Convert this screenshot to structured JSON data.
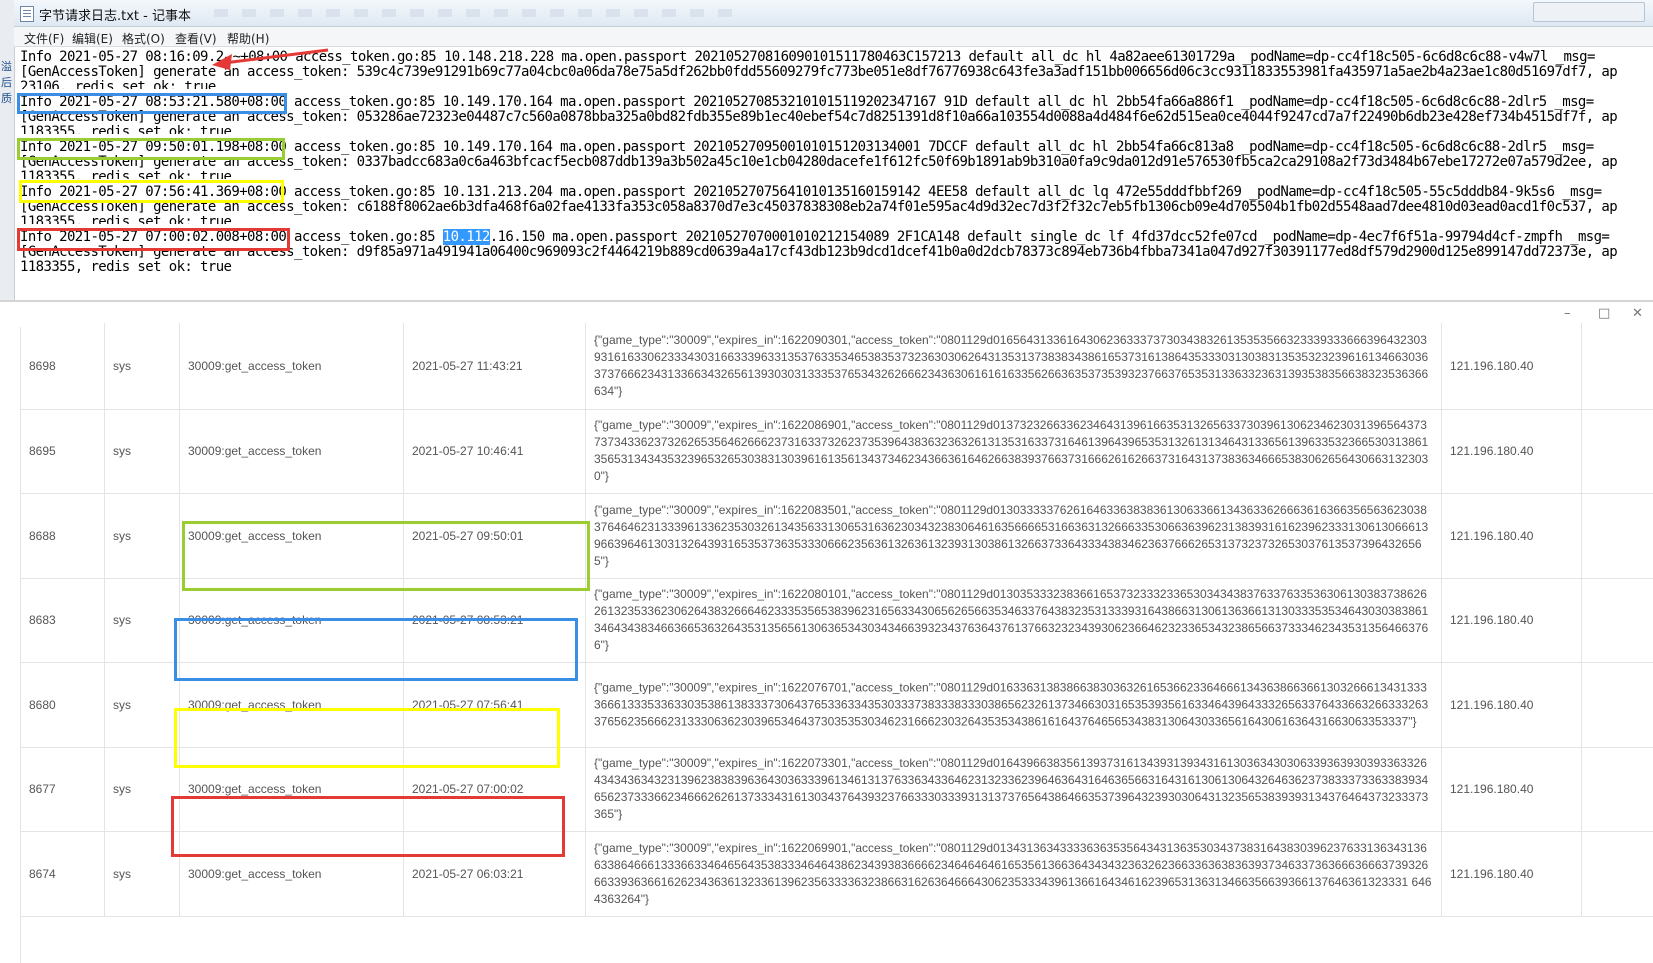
{
  "notepad": {
    "title": "字节请求日志.txt - 记事本",
    "side_chars": [
      "溢",
      "后",
      "质"
    ],
    "menu": [
      "文件(F)",
      "编辑(E)",
      "格式(O)",
      "查看(V)",
      "帮助(H)"
    ],
    "lines": [
      {
        "pre": "Info 2021-05-27 08:16:09.",
        "sel": "",
        "post": "2̵̴+08:00 access_token.go:85 10.148.218.228 ma.open.passport 202105270816090101511780463C157213 default all_dc hl 4a82aee61301729a _podName=dp-cc4f18c505-6c6d8c6c88-v4w7l _msg="
      },
      {
        "pre": "[GenAccessToken] generate an access_token: 539c4c739e91291b69c77a04cbc0a06da78e75a5df262bb0fdd55609279fc773be051e8df76776938c643fe3a3adf151bb006656d06c3cc9311833553981fa435971a5ae2b4a23ae1c80d51697df7, ap",
        "sel": "",
        "post": ""
      },
      {
        "pre": "23106, redis set ok: true",
        "sel": "",
        "post": "",
        "cut": true
      },
      {
        "pre": "Info 2021-05-27 08:53:21.580+08:00 access_token.go:85 10.149.170.164 ma.open.passport 2021052708532101015119202347167 91D default all_dc hl 2bb54fa66a886f1 _podName=dp-cc4f18c505-6c6d8c6c88-2dlr5 _msg=",
        "sel": "",
        "post": ""
      },
      {
        "pre": "[GenAccessToken] generate an access_token: 053286ae72323e04487c7c560a0878bba325a0bd82fdb355e89b1ec40ebef54c7d8251391d8f10a66a103554d0088a4d484f6e62d515ea0ce4044f9247cd7a7f22490b6db23e428ef734b4515df7f, ap",
        "sel": "",
        "post": ""
      },
      {
        "pre": "1183355, redis set ok: true",
        "sel": "",
        "post": "",
        "cut": true
      },
      {
        "pre": "Info 2021-05-27 09:50:01.198+08:00 access_token.go:85 10.149.170.164 ma.open.passport 20210527095001010151203134001 7DCCF default all_dc hl 2bb54fa66c813a8 _podName=dp-cc4f18c505-6c6d8c6c88-2dlr5 _msg=",
        "sel": "",
        "post": ""
      },
      {
        "pre": "[GenAccessToken] generate an access_token: 0337badcc683a0c6a463bfcacf5ecb087ddb139a3b502a45c10e1cb04280dacefe1f612fc50f69b1891ab9b310a0fa9c9da012d91e576530fb5ca2ca29108a2f73d3484b67ebe17272e07a579d2ee, ap",
        "sel": "",
        "post": ""
      },
      {
        "pre": "1183355, redis set ok: true",
        "sel": "",
        "post": "",
        "cut": true
      },
      {
        "pre": "Info 2021-05-27 07:56:41.369+08:00 access_token.go:85 10.131.213.204 ma.open.passport 20210527075641010135160159142 4EE58 default all_dc lq 472e55dddfbbf269 _podName=dp-cc4f18c505-55c5dddb84-9k5s6 _msg=",
        "sel": "",
        "post": ""
      },
      {
        "pre": "[GenAccessToken] generate an access_token: c6188f8062ae6b3dfa468f6a02fae4133fa353c058a8370d7e3c45037838308eb2a74f01e595ac4d9d32ec7d3f2f32c7eb5fb1306cb09e4d705504b1fb02d5548aad7dee4810d03ead0acd1f0c537, ap",
        "sel": "",
        "post": ""
      },
      {
        "pre": "1183355, redis set ok: true",
        "sel": "",
        "post": "",
        "cut": true
      },
      {
        "pre": "Info 2021-05-27 07:00:02.008+08:00 access_token.go:85 ",
        "sel": "10.112",
        "post": ".16.150 ma.open.passport 20210527070001010212154089 2F1CA148 default single_dc lf 4fd37dcc52fe07cd _podName=dp-4ec7f6f51a-99794d4cf-zmpfh _msg="
      },
      {
        "pre": "[GenAccessToken] generate an access_token: d9f85a971a491941a06400c969093c2f4464219b889cd0639a4a17cf43db123b9dcd1dcef41b0a0d2dcb78373c894eb736b4fbba7341a047d927f30391177ed8df579d2900d125e899147dd72373e, ap",
        "sel": "",
        "post": ""
      },
      {
        "pre": "1183355, redis set ok: true",
        "sel": "",
        "post": ""
      }
    ]
  },
  "table_window": {
    "controls": [
      "–",
      "□",
      "✕"
    ]
  },
  "table": {
    "rows": [
      {
        "id": "8698",
        "user": "sys",
        "action": "30009:get_access_token",
        "time": "2021-05-27 11:43:21",
        "response": "{\"game_type\":\"30009\",\"expires_in\":1622090301,\"access_token\":\"0801129d016564313361643062363337373034383261353535663233393336663964323039316163306233343031663339633135376335346538353732363030626431353137383834386165373161386435333031303831353532323961613466303637376662343133663432656139303031333537653432626662343630616161633562663635373539323766376535313363323631393538356638323536366634\"}",
        "ip": "121.196.180.40"
      },
      {
        "id": "8695",
        "user": "sys",
        "action": "30009:get_access_token",
        "time": "2021-05-27 10:46:41",
        "response": "{\"game_type\":\"30009\",\"expires_in\":1622086901,\"access_token\":\"0801129d0137323266336234643139616635313265633730396130623462303139656437373734336237326265356462666237316337326237353964383632363261313531633731646139643965353132613134643133656139633532366530313861356531343435323965326530383130396161356134373462343663616462663839376637316662616266373164313738363466653830626564306631323030\"}",
        "ip": "121.196.180.40"
      },
      {
        "id": "8688",
        "user": "sys",
        "action": "30009:get_access_token",
        "time": "2021-05-27 09:50:01",
        "response": "{\"game_type\":\"30009\",\"expires_in\":1622083501,\"access_token\":\"0801129d013033333762616463363838361306336613436336266636163663565636230383764646231333961336235303261343563313065316362303432383064616356666531663631326663353066363962313839316162396233313061306661396639646130313264393165353736353330666235636132636132393130386132663733643334383462363766626531373237326530376135373964326565\"}",
        "ip": "121.196.180.40"
      },
      {
        "id": "8683",
        "user": "sys",
        "action": "30009:get_access_token",
        "time": "2021-05-27 08:53:21",
        "response": "{\"game_type\":\"30009\",\"expires_in\":1622080101,\"access_token\":\"0801129d0130353332383661653732333233653034343837633763353630613038373862626132353362306264383266646233353565383962316563343065626566353463376438323531333931643866313061363661313033353534643030383861346434383466366536326435313565613063653430343466393234376364376137663232343930623664623233653432386566373334623435313564663766\"}",
        "ip": "121.196.180.40"
      },
      {
        "id": "8680",
        "user": "sys",
        "action": "30009:get_access_token",
        "time": "2021-05-27 07:56:41",
        "response": "{\"game_type\":\"30009\",\"expires_in\":1622076701,\"access_token\":\"0801129d016336313838663830363261653662336466613436386636613032666134313333666133353363303538613833373064376533633435303337383338333038656232613734663031653539356163346439643332656337643366326633326337656235666231333063623039653464373035353034623166623032643535343861616437646565343831306430336561643061636431663063353337\"}",
        "ip": "121.196.180.40"
      },
      {
        "id": "8677",
        "user": "sys",
        "action": "30009:get_access_token",
        "time": "2021-05-27 07:00:02",
        "response": "{\"game_type\":\"30009\",\"expires_in\":1622073301,\"access_token\":\"0801129d016439663835613937316134393139343161303634303063393639303933633264343436343231396238383963643036333961346131376336343364623132336239646364316463656631643161306130643264636237383337336338393465623733366234666262613733343161303437643932376633303339313137376564386466353739643239303064313235653839393134376464373233373365\"}",
        "ip": "121.196.180.40"
      },
      {
        "id": "8674",
        "user": "sys",
        "action": "30009:get_access_token",
        "time": "2021-05-27 06:03:21",
        "response": "{\"game_type\":\"30009\",\"expires_in\":1622069901,\"access_token\":\"0801129d013431363433336363535643431363530343738316438303962376331363431366338646661333663346465643538333464643862343938366662346464646165356136636434343236326236633636383639373463373636663666373932666339363661626234363613233613962356333363238663162636466643062353334396136616434616239653136313466356639366137646361323331 6464363264\"}",
        "ip": "121.196.180.40"
      }
    ]
  },
  "highlights": {
    "colors": {
      "blue": "#3a8ee6",
      "green": "#9acd32",
      "yellow": "#ffff00",
      "red": "#e53935",
      "arrow": "#e53935"
    }
  }
}
